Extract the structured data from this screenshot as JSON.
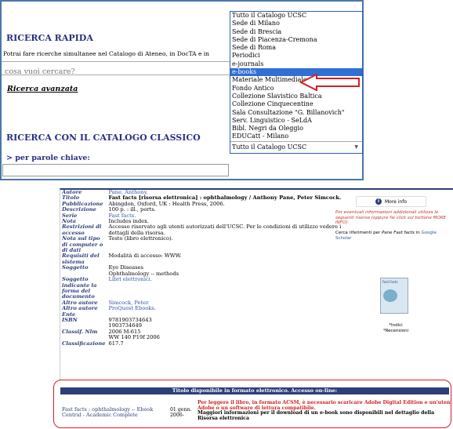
{
  "quick_search": {
    "title": "RICERCA RAPIDA",
    "description": "Potrai fare ricerche simultanee nel Catalogo di Ateneo, in DocTA e in",
    "placeholder": "cosa vuoi cercare?",
    "advanced_link": "Ricerca avanzata"
  },
  "classic_search": {
    "title": "RICERCA CON IL CATALOGO CLASSICO",
    "keywords_label": "> per parole chiave:"
  },
  "catalog_dropdown": {
    "options": [
      "Tutto il Catalogo UCSC",
      "Sede di Milano",
      "Sede di Brescia",
      "Sede di Piacenza-Cremona",
      "Sede di Roma",
      "Periodici",
      "e-journals",
      "e-books",
      "Materiale Multimediale",
      "Fondo Antico",
      "Collezione Slavistico Baltica",
      "Collezione Cinquecentine",
      "Sala Consultazione \"G. Billanovich\"",
      "Serv. Linguistico - SeLdA",
      "Bibl. Negri da Oleggio",
      "EDUCatt - Milano"
    ],
    "highlighted": "e-books",
    "selected_value": "Tutto il Catalogo UCSC",
    "highlight_color": "#2f6fd6"
  },
  "record": {
    "fields": [
      {
        "label": "Autore",
        "value": "Pane, Anthony.",
        "link": true
      },
      {
        "label": "Titolo",
        "value": "Fast facts [risorsa elettronica] : ophthalmology / Anthony Pane, Peter Simcock.",
        "bold": true
      },
      {
        "label": "Pubblicazione",
        "value": "Abingdon, Oxford, UK : Health Press, 2006."
      },
      {
        "label": "Descrizione",
        "value": "100 p. : ill., ports."
      },
      {
        "label": "Serie",
        "value": "Fast facts.",
        "link": true
      },
      {
        "label": "Nota",
        "value": "Includes index."
      },
      {
        "label": "Restrizioni di accesso",
        "value": "Accesso riservato agli utenti autorizzati dell'UCSC. Per le condizioni di utilizzo vedere i dettagli della risorsa."
      },
      {
        "label": "Nota sul tipo di computer o di dati",
        "value": "Testo (libro elettronico)."
      },
      {
        "label": "Requisiti del sistema",
        "value": "Modalità di accesso: WWW."
      },
      {
        "label": "Soggetto",
        "value": "Eye Diseases\nOphthalmology -- methods"
      },
      {
        "label": "Soggetto indicante la forma del documento",
        "value": "Libri elettronici.",
        "link": true
      },
      {
        "label": "Altro autore",
        "value": "Simcock, Peter.",
        "link": true
      },
      {
        "label": "Altro autore Ente",
        "value": "ProQuest Ebooks.",
        "link": true
      },
      {
        "label": "ISBN",
        "value": "9781903734643\n1903734649"
      },
      {
        "label": "Classif. Nlm",
        "value": "2006 M-615\nWW 140 P19f 2006"
      },
      {
        "label": "Classificazione",
        "value": "617.7"
      }
    ],
    "more_info": "More info",
    "note_red": "Per eventuali informazioni addizionali utilizza le seguenti risorse (oppure fai click sul bottone MORE INFO):",
    "note_find_prefix": "Cerca riferimenti per ",
    "note_find_title": "Pane Fast facts",
    "note_find_mid": " in ",
    "note_find_link": "Google Scholar",
    "cover_text": "Fast Facts",
    "indici": "*Indici",
    "recensioni": "*Recensioni"
  },
  "online": {
    "header": "Titolo disponibile in formato elettronico. Accesso on-line:",
    "link": "Fast facts : ophthalmology -- Ebook Central - Academic Complete",
    "date": "01 genn. 2006-",
    "info_red": "Per leggere il libro, in formato ACSM, è necessario scaricare Adobe Digital Edition e un'utenza Adobe o un software di lettura compatibile.",
    "info_bold": "Maggiori informazioni per il download di un e-book sono disponibili nel dettaglio della Risorsa elettronica",
    "border_color": "#d32020",
    "header_color": "#2d3f79"
  }
}
